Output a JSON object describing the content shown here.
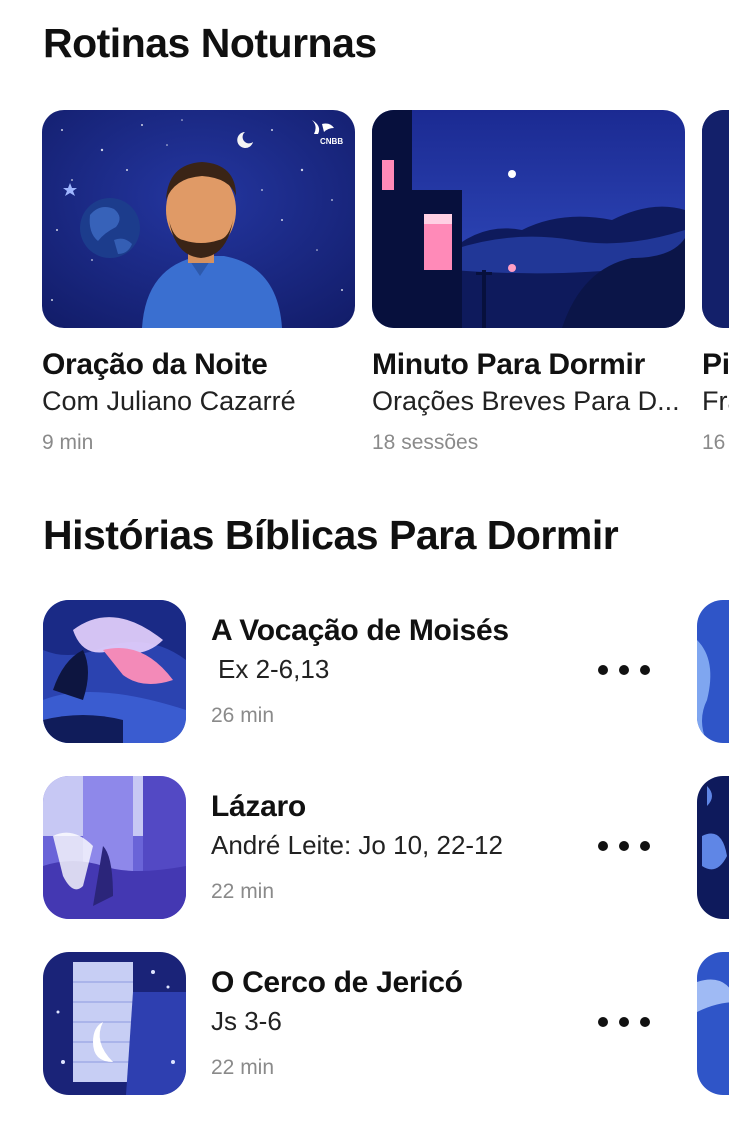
{
  "sections": {
    "night_routines": {
      "title": "Rotinas Noturnas",
      "cards": [
        {
          "title": "Oração da Noite",
          "subtitle": "Com Juliano Cazarré",
          "meta": "9 min",
          "badge": "CNBB"
        },
        {
          "title": "Minuto Para Dormir",
          "subtitle": "Orações Breves Para D...",
          "meta": "18 sessões"
        },
        {
          "title": "Pi",
          "subtitle": "Fra",
          "meta": "16"
        }
      ]
    },
    "bible_stories": {
      "title": "Histórias Bíblicas Para Dormir",
      "items": [
        {
          "title": "A Vocação de Moisés",
          "subtitle": "Ex 2-6,13",
          "meta": "26 min"
        },
        {
          "title": "Lázaro",
          "subtitle": "André Leite: Jo 10, 22-12",
          "meta": "22 min"
        },
        {
          "title": "O Cerco de Jericó",
          "subtitle": "Js 3-6",
          "meta": "22 min"
        }
      ]
    }
  },
  "icons": {
    "more": "more-horizontal-icon"
  },
  "colors": {
    "night_blue": "#1a2a8a",
    "deep_navy": "#0b1240",
    "text_primary": "#111111",
    "text_muted": "#8a8a8a"
  }
}
